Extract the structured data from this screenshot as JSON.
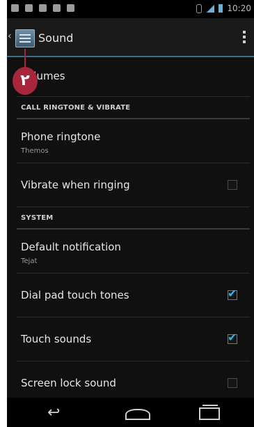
{
  "status_bar": {
    "time": "10:20"
  },
  "action_bar": {
    "title": "Sound"
  },
  "marker": {
    "label": "٢"
  },
  "settings": {
    "volumes": "Volumes",
    "header_ringtone": "CALL RINGTONE & VIBRATE",
    "phone_ringtone": {
      "title": "Phone ringtone",
      "value": "Themos"
    },
    "vibrate_when_ringing": {
      "title": "Vibrate when ringing",
      "checked": false
    },
    "header_system": "SYSTEM",
    "default_notification": {
      "title": "Default notification",
      "value": "Tejat"
    },
    "dial_pad_touch_tones": {
      "title": "Dial pad touch tones",
      "checked": true
    },
    "touch_sounds": {
      "title": "Touch sounds",
      "checked": true
    },
    "screen_lock_sound": {
      "title": "Screen lock sound",
      "checked": false
    }
  },
  "colors": {
    "accent": "#33b5e5",
    "marker": "#a8263c",
    "background": "#101010"
  }
}
